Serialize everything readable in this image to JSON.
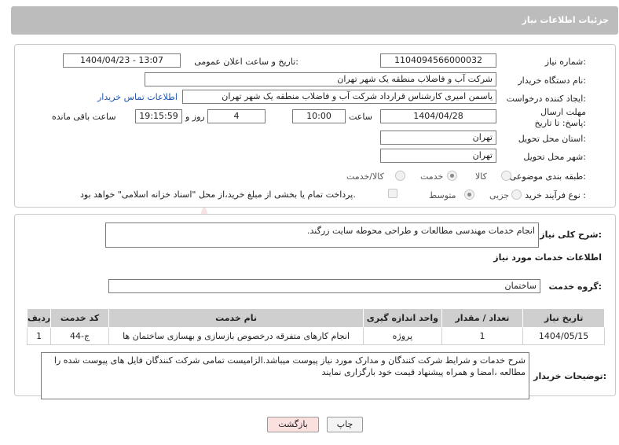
{
  "header": {
    "title": "جزئیات اطلاعات نیاز"
  },
  "form": {
    "need_number_label": "شماره نیاز:",
    "need_number": "1104094566000032",
    "announce_label": "تاریخ و ساعت اعلان عمومی:",
    "announce_value": "1404/04/23 - 13:07",
    "buyer_org_label": "نام دستگاه خریدار:",
    "buyer_org": "شرکت آب و فاضلاب منطقه یک شهر تهران",
    "requester_label": "ایجاد کننده درخواست:",
    "requester": "یاسمن امیری کارشناس قرارداد شرکت آب و فاضلاب منطقه یک شهر تهران",
    "buyer_contact_link": "اطلاعات تماس خریدار",
    "deadline_label": "مهلت ارسال پاسخ: تا تاریخ:",
    "deadline_date": "1404/04/28",
    "time_label": "ساعت",
    "deadline_time": "10:00",
    "days_value": "4",
    "days_label": "روز و",
    "remaining_time": "19:15:59",
    "remaining_label": "ساعت باقی مانده",
    "province_label": "استان محل تحویل:",
    "province": "تهران",
    "city_label": "شهر محل تحویل:",
    "city": "تهران",
    "category_label": "طبقه بندی موضوعی:",
    "category_options": [
      "کالا",
      "خدمت",
      "کالا/خدمت"
    ],
    "category_selected": "خدمت",
    "process_label": "نوع فرآیند خرید :",
    "process_options": [
      "جزیی",
      "متوسط"
    ],
    "process_selected": "متوسط",
    "payment_note": "پرداخت تمام یا بخشی از مبلغ خرید،از محل \"اسناد خزانه اسلامی\" خواهد بود."
  },
  "summary": {
    "label": "شرح کلی نیاز:",
    "text": "انجام خدمات مهندسی مطالعات و طراحی محوطه سایت زرگند."
  },
  "services": {
    "section_title": "اطلاعات خدمات مورد نیاز",
    "group_label": "گروه خدمت:",
    "group_value": "ساختمان",
    "columns": [
      "ردیف",
      "کد خدمت",
      "نام خدمت",
      "واحد اندازه گیری",
      "تعداد / مقدار",
      "تاریخ نیاز"
    ],
    "rows": [
      [
        "1",
        "ج-44",
        "انجام کارهای متفرقه درخصوص بازسازی و بهسازی ساختمان ها",
        "پروژه",
        "1",
        "1404/05/15"
      ]
    ]
  },
  "buyer_notes": {
    "label": "توضیحات خریدار:",
    "text": "شرح خدمات و شرایط شرکت کنندگان و مدارک مورد نیاز پیوست میباشد.الزامیست تمامی شرکت کنندگان فایل های پیوست شده را مطالعه ،امضا و همراه پیشنهاد قیمت خود بارگزاری نمایند"
  },
  "buttons": {
    "print": "چاپ",
    "back": "بازگشت"
  },
  "watermark": {
    "text": "AriaTender.neT"
  },
  "colors": {
    "header": "#bcbcbc",
    "link": "#1a56b5",
    "back_button": "#fbe0e0",
    "watermark": "#c0392b"
  }
}
